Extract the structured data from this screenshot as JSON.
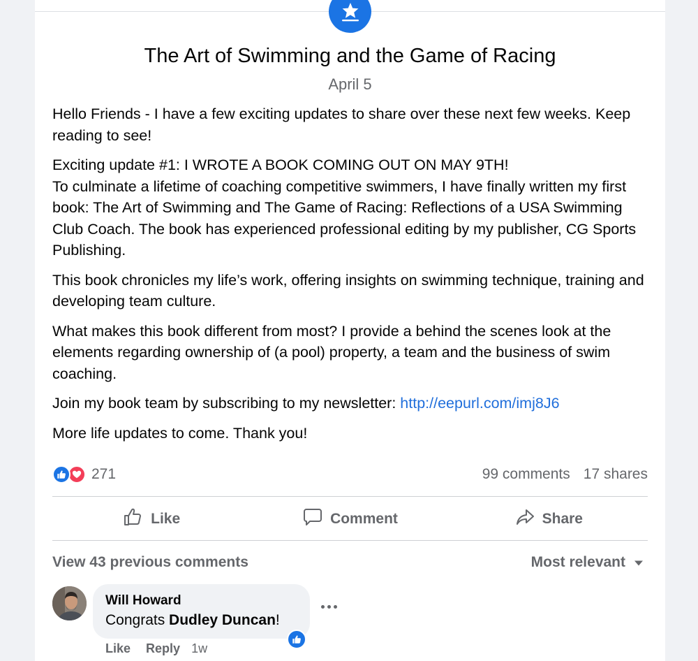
{
  "post": {
    "title": "The Art of Swimming and the Game of Racing",
    "date": "April 5",
    "paragraphs": {
      "p1": "Hello Friends - I have a few exciting updates to share over these next few weeks. Keep reading to see!",
      "p2_line1": "Exciting update #1: I WROTE A BOOK COMING OUT ON MAY 9TH!",
      "p2_line2": "To culminate a lifetime of coaching competitive swimmers, I have finally written my first book: The Art of Swimming and The Game of Racing: Reflections of a USA Swimming Club Coach. The book has experienced professional editing by my publisher, CG Sports Publishing.",
      "p3": "This book chronicles my life’s work, offering insights on swimming technique, training and developing team culture.",
      "p4": "What makes this book different from most? I provide a behind the scenes look at the elements regarding ownership of (a pool) property, a team and the business of swim coaching.",
      "p5_text": "Join my book team by subscribing to my newsletter: ",
      "p5_link": "http://eepurl.com/imj8J6",
      "p6": "More life updates to come. Thank you!"
    }
  },
  "stats": {
    "reaction_count": "271",
    "comments": "99 comments",
    "shares": "17 shares"
  },
  "actions": {
    "like": "Like",
    "comment": "Comment",
    "share": "Share"
  },
  "comments_section": {
    "view_previous": "View 43 previous comments",
    "sort_label": "Most relevant",
    "comment": {
      "author": "Will Howard",
      "text_prefix": "Congrats ",
      "mention": "Dudley Duncan",
      "text_suffix": "!",
      "like_label": "Like",
      "reply_label": "Reply",
      "time": "1w"
    }
  },
  "icons": {
    "badge": "star-badge-icon",
    "like_reaction": "thumbs-up-icon",
    "love_reaction": "heart-icon",
    "like_action": "thumbs-up-outline-icon",
    "comment_action": "speech-bubble-icon",
    "share_action": "share-arrow-icon",
    "sort": "caret-down-icon",
    "more": "ellipsis-icon"
  },
  "colors": {
    "accent": "#1b74e4",
    "love": "#f33e58",
    "link": "#216fdb",
    "secondary_text": "#65676b"
  }
}
